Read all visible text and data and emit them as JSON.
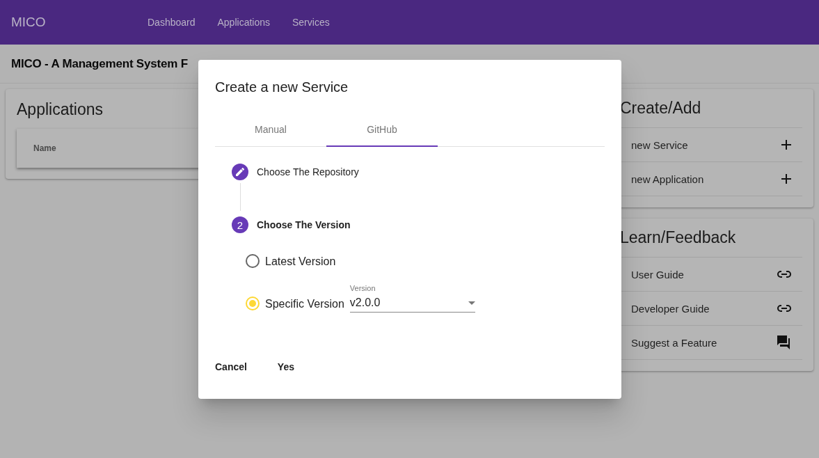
{
  "nav": {
    "brand": "MICO",
    "links": [
      "Dashboard",
      "Applications",
      "Services"
    ]
  },
  "page_title": "MICO - A Management System F",
  "applications": {
    "title": "Applications",
    "columns": [
      "Name"
    ]
  },
  "panels": [
    {
      "title": "Create/Add",
      "items": [
        {
          "label": "new Service",
          "kind": "plus"
        },
        {
          "label": "new Application",
          "kind": "plus"
        }
      ]
    },
    {
      "title": "Learn/Feedback",
      "items": [
        {
          "label": "User Guide",
          "kind": "link"
        },
        {
          "label": "Developer Guide",
          "kind": "link"
        },
        {
          "label": "Suggest a Feature",
          "kind": "chat"
        }
      ]
    }
  ],
  "dialog": {
    "title": "Create a new Service",
    "tabs": [
      {
        "label": "Manual",
        "selected": false
      },
      {
        "label": "GitHub",
        "selected": true
      }
    ],
    "steps": [
      {
        "kind": "edit",
        "label": "Choose The Repository",
        "active": false
      },
      {
        "kind": "number",
        "number": "2",
        "label": "Choose The Version",
        "active": true
      }
    ],
    "options": [
      {
        "label": "Latest Version",
        "selected": false
      },
      {
        "label": "Specific Version",
        "selected": true
      }
    ],
    "select": {
      "label": "Version",
      "value": "v2.0.0"
    },
    "buttons": [
      "Cancel",
      "Yes"
    ]
  }
}
